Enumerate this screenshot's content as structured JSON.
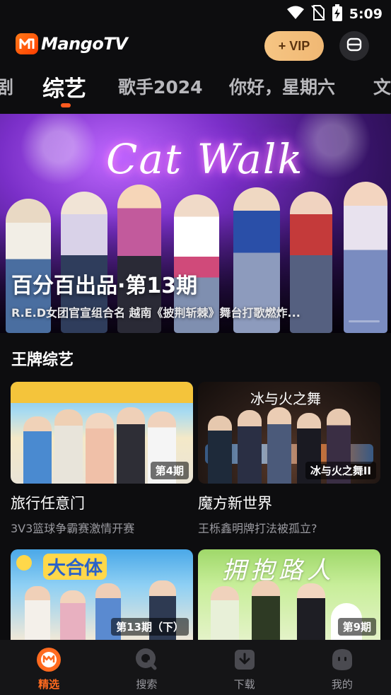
{
  "status_bar": {
    "time": "5:09"
  },
  "header": {
    "logo_text": "MangoTV",
    "vip_label": "+ VIP"
  },
  "tabs": [
    {
      "label": "剧",
      "active": false
    },
    {
      "label": "综艺",
      "active": true
    },
    {
      "label": "歌手2024",
      "active": false
    },
    {
      "label": "你好，星期六",
      "active": false
    },
    {
      "label": "文",
      "active": false
    }
  ],
  "banner": {
    "neon_text": "Cat Walk",
    "title": "百分百出品·第13期",
    "subtitle": "R.E.D女团官宣组合名 越南《披荆斩棘》舞台打歌燃炸..."
  },
  "section": {
    "title": "王牌综艺"
  },
  "cards": [
    {
      "badge": "第4期",
      "title": "旅行任意门",
      "subtitle": "3V3篮球争霸赛激情开赛"
    },
    {
      "badge": "冰与火之舞II",
      "title": "魔方新世界",
      "subtitle": "王栎鑫明牌打法被孤立?",
      "logo_text": "冰与火之舞"
    },
    {
      "badge": "第13期（下）",
      "title": "",
      "subtitle": "",
      "logo_text": "大合体"
    },
    {
      "badge": "第9期",
      "title": "",
      "subtitle": "",
      "logo_text": "拥抱路人"
    }
  ],
  "bottom_nav": [
    {
      "label": "精选",
      "icon": "mango-home-icon",
      "active": true
    },
    {
      "label": "搜索",
      "icon": "search-icon",
      "active": false
    },
    {
      "label": "下载",
      "icon": "download-icon",
      "active": false
    },
    {
      "label": "我的",
      "icon": "profile-icon",
      "active": false
    }
  ],
  "colors": {
    "accent": "#ff5a1f",
    "vip_gold": "#f6c583",
    "background": "#0d0d0f"
  }
}
